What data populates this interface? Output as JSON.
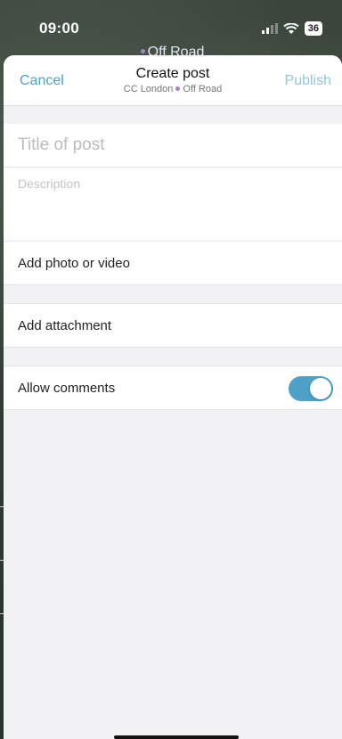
{
  "status": {
    "time": "09:00",
    "battery": "36"
  },
  "background": {
    "peek_title": "Off Road"
  },
  "nav": {
    "cancel": "Cancel",
    "title": "Create post",
    "group": "CC London",
    "channel": "Off Road",
    "publish": "Publish"
  },
  "form": {
    "title_placeholder": "Title of post",
    "description_placeholder": "Description",
    "add_media": "Add photo or video",
    "add_attachment": "Add attachment",
    "allow_comments": "Allow comments",
    "allow_comments_on": true
  },
  "colors": {
    "accent": "#4da1c6",
    "publish_disabled": "#8fc7de"
  }
}
